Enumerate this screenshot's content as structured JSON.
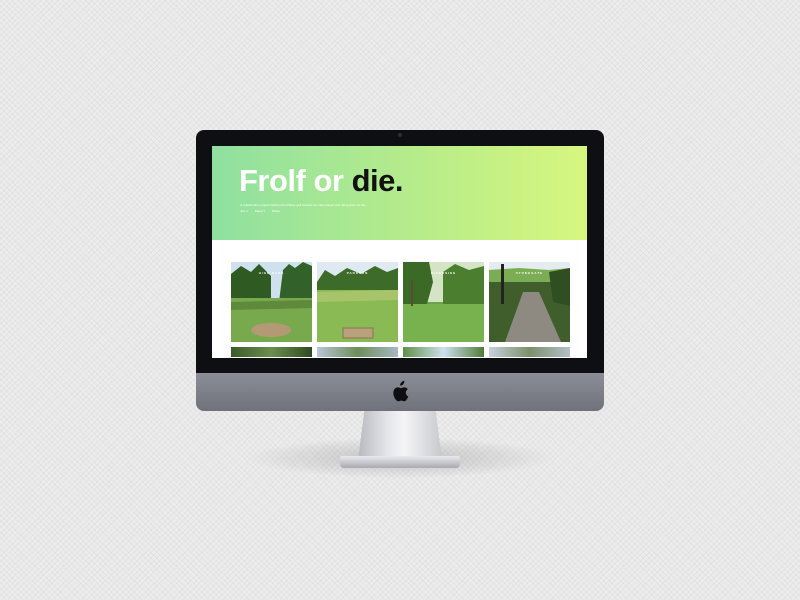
{
  "site": {
    "title_part1": "Frolf or ",
    "title_part2": "die.",
    "description": "A collaborative project tracking the frisbee golf courses we have played and rating them for the...",
    "meta": [
      "July 4",
      "Rated 7",
      "Share"
    ]
  },
  "courses": [
    {
      "name": "HIGH PARK"
    },
    {
      "name": "PARKTON"
    },
    {
      "name": "RIVERSIDE"
    },
    {
      "name": "STONEGATE"
    }
  ],
  "colors": {
    "gradient_start": "#8fe0a0",
    "gradient_end": "#d7f67e",
    "bezel": "#0d0f12",
    "chin": "#7a7c86"
  },
  "icons": {
    "brand": "apple-logo-icon"
  }
}
